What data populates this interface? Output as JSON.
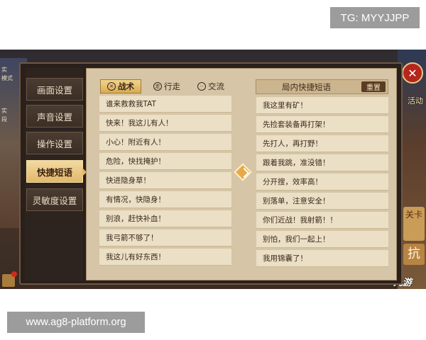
{
  "watermarks": {
    "tg": "TG: MYYJJPP",
    "site": "www.ag8-platform.org"
  },
  "hud": {
    "left_texts": [
      "实",
      "模式",
      "实",
      "段"
    ],
    "right_activity": "活动",
    "right_card": "关卡",
    "right_card2": "抗",
    "jiuyou_logo": "九游",
    "close_icon": "✕"
  },
  "sidebar": {
    "items": [
      {
        "label": "画面设置",
        "active": false
      },
      {
        "label": "声音设置",
        "active": false
      },
      {
        "label": "操作设置",
        "active": false
      },
      {
        "label": "快捷短语",
        "active": true
      },
      {
        "label": "灵敏度设置",
        "active": false
      }
    ]
  },
  "tabs": [
    {
      "label": "战术",
      "icon": "crossed-swords-icon",
      "active": true
    },
    {
      "label": "行走",
      "icon": "walk-icon",
      "active": false
    },
    {
      "label": "交流",
      "icon": "chat-icon",
      "active": false
    }
  ],
  "phrases_left": [
    "谁来救救我TAT",
    "快来！我这儿有人！",
    "小心！附近有人！",
    "危险，快找掩护！",
    "快进隐身草！",
    "有情况，快隐身！",
    "别浪，赶快补血！",
    "我弓箭不够了！",
    "我这儿有好东西！"
  ],
  "right_panel": {
    "title": "局内快捷短语",
    "reset_label": "重置",
    "phrases": [
      "我这里有矿！",
      "先捡套装备再打架！",
      "先打人，再打野！",
      "跟着我跳，准没错！",
      "分开搜，效率高！",
      "别落单，注意安全！",
      "你们近战！我射箭！！",
      "别怕，我们一起上！",
      "我用锦囊了！"
    ]
  },
  "colors": {
    "active_tab": "#e2b86b",
    "panel_bg": "#d6c5a6",
    "close_red": "#b5261c"
  }
}
